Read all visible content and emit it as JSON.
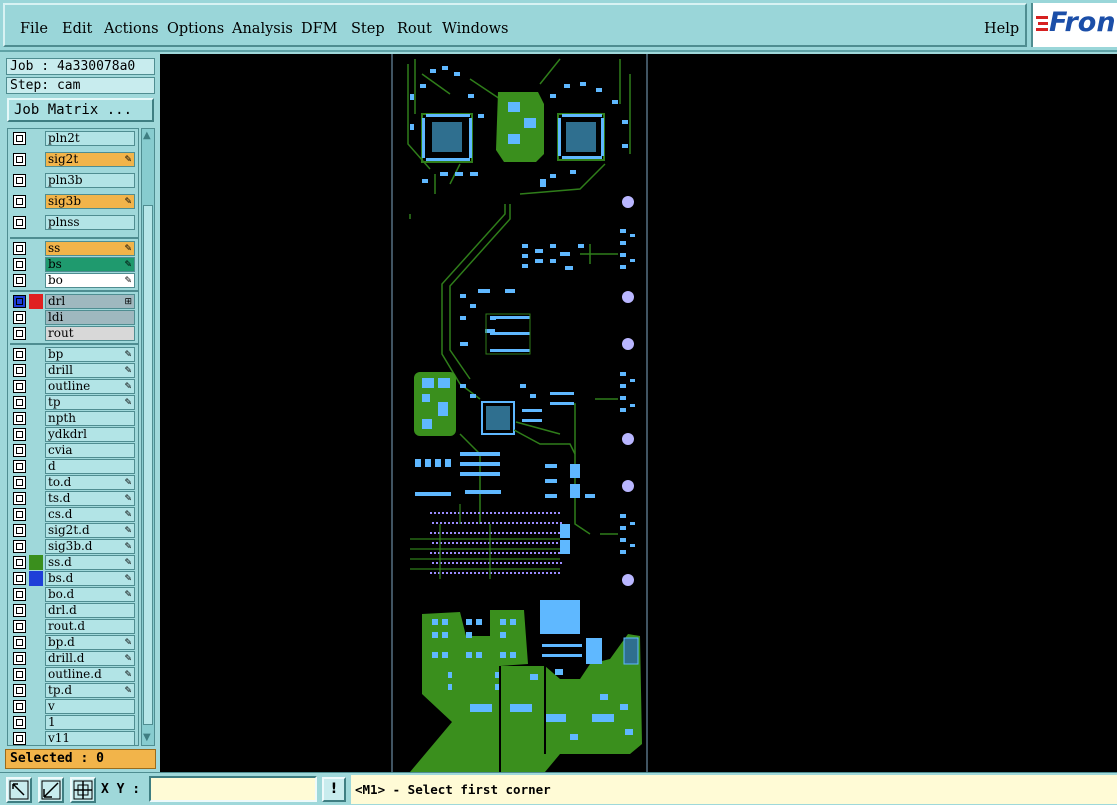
{
  "menu": {
    "file": "File",
    "edit": "Edit",
    "actions": "Actions",
    "options": "Options",
    "analysis": "Analysis",
    "dfm": "DFM",
    "step": "Step",
    "rout": "Rout",
    "windows": "Windows",
    "help": "Help"
  },
  "logo": {
    "text": "Fron"
  },
  "job": {
    "label": "Job : 4a330078a0",
    "step": "Step: cam"
  },
  "job_matrix_label": "Job Matrix ...",
  "layers": [
    {
      "name": "pln2t",
      "color": "#b2e4e6",
      "flag": "",
      "swatch": ""
    },
    {
      "name": "sig2t",
      "color": "#f2b44a",
      "flag": "✎",
      "swatch": ""
    },
    {
      "name": "pln3b",
      "color": "#b2e4e6",
      "flag": "",
      "swatch": ""
    },
    {
      "name": "sig3b",
      "color": "#f2b44a",
      "flag": "✎",
      "swatch": ""
    },
    {
      "name": "plnss",
      "color": "#b2e4e6",
      "flag": "",
      "swatch": ""
    },
    {
      "name": "ss",
      "color": "#f2b44a",
      "flag": "✎",
      "swatch": ""
    },
    {
      "name": "bs",
      "color": "#1f9a6e",
      "flag": "✎",
      "swatch": ""
    },
    {
      "name": "bo",
      "color": "#ffffff",
      "flag": "✎",
      "swatch": ""
    },
    {
      "name": "drl",
      "color": "#9fb8bf",
      "flag": "⊞",
      "swatch": "#e02020"
    },
    {
      "name": "ldi",
      "color": "#9fb8bf",
      "flag": "",
      "swatch": ""
    },
    {
      "name": "rout",
      "color": "#d8d8d8",
      "flag": "",
      "swatch": ""
    },
    {
      "name": "bp",
      "color": "#b2e4e6",
      "flag": "✎",
      "swatch": ""
    },
    {
      "name": "drill",
      "color": "#b2e4e6",
      "flag": "✎",
      "swatch": ""
    },
    {
      "name": "outline",
      "color": "#b2e4e6",
      "flag": "✎",
      "swatch": ""
    },
    {
      "name": "tp",
      "color": "#b2e4e6",
      "flag": "✎",
      "swatch": ""
    },
    {
      "name": "npth",
      "color": "#b2e4e6",
      "flag": "",
      "swatch": ""
    },
    {
      "name": "ydkdrl",
      "color": "#b2e4e6",
      "flag": "",
      "swatch": ""
    },
    {
      "name": "cvia",
      "color": "#b2e4e6",
      "flag": "",
      "swatch": ""
    },
    {
      "name": "d",
      "color": "#b2e4e6",
      "flag": "",
      "swatch": ""
    },
    {
      "name": "to.d",
      "color": "#b2e4e6",
      "flag": "✎",
      "swatch": ""
    },
    {
      "name": "ts.d",
      "color": "#b2e4e6",
      "flag": "✎",
      "swatch": ""
    },
    {
      "name": "cs.d",
      "color": "#b2e4e6",
      "flag": "✎",
      "swatch": ""
    },
    {
      "name": "sig2t.d",
      "color": "#b2e4e6",
      "flag": "✎",
      "swatch": ""
    },
    {
      "name": "sig3b.d",
      "color": "#b2e4e6",
      "flag": "✎",
      "swatch": ""
    },
    {
      "name": "ss.d",
      "color": "#b2e4e6",
      "flag": "✎",
      "swatch": "#3a8f1d"
    },
    {
      "name": "bs.d",
      "color": "#b2e4e6",
      "flag": "✎",
      "swatch": "#1e3ed8"
    },
    {
      "name": "bo.d",
      "color": "#b2e4e6",
      "flag": "✎",
      "swatch": ""
    },
    {
      "name": "drl.d",
      "color": "#b2e4e6",
      "flag": "",
      "swatch": ""
    },
    {
      "name": "rout.d",
      "color": "#b2e4e6",
      "flag": "",
      "swatch": ""
    },
    {
      "name": "bp.d",
      "color": "#b2e4e6",
      "flag": "✎",
      "swatch": ""
    },
    {
      "name": "drill.d",
      "color": "#b2e4e6",
      "flag": "✎",
      "swatch": ""
    },
    {
      "name": "outline.d",
      "color": "#b2e4e6",
      "flag": "✎",
      "swatch": ""
    },
    {
      "name": "tp.d",
      "color": "#b2e4e6",
      "flag": "✎",
      "swatch": ""
    },
    {
      "name": "v",
      "color": "#b2e4e6",
      "flag": "",
      "swatch": ""
    },
    {
      "name": "1",
      "color": "#b2e4e6",
      "flag": "",
      "swatch": ""
    },
    {
      "name": "v11",
      "color": "#b2e4e6",
      "flag": "",
      "swatch": ""
    }
  ],
  "selected": "Selected : 0",
  "status": {
    "xy_label": "X Y :",
    "xy_value": "",
    "msg_button": "!",
    "prompt": "<M1> - Select first corner"
  },
  "colors": {
    "board_green": "#3a8f1d",
    "pad_blue": "#5fb8ff",
    "trace_green": "#2f7d1a",
    "outline": "#7fa9c4"
  }
}
